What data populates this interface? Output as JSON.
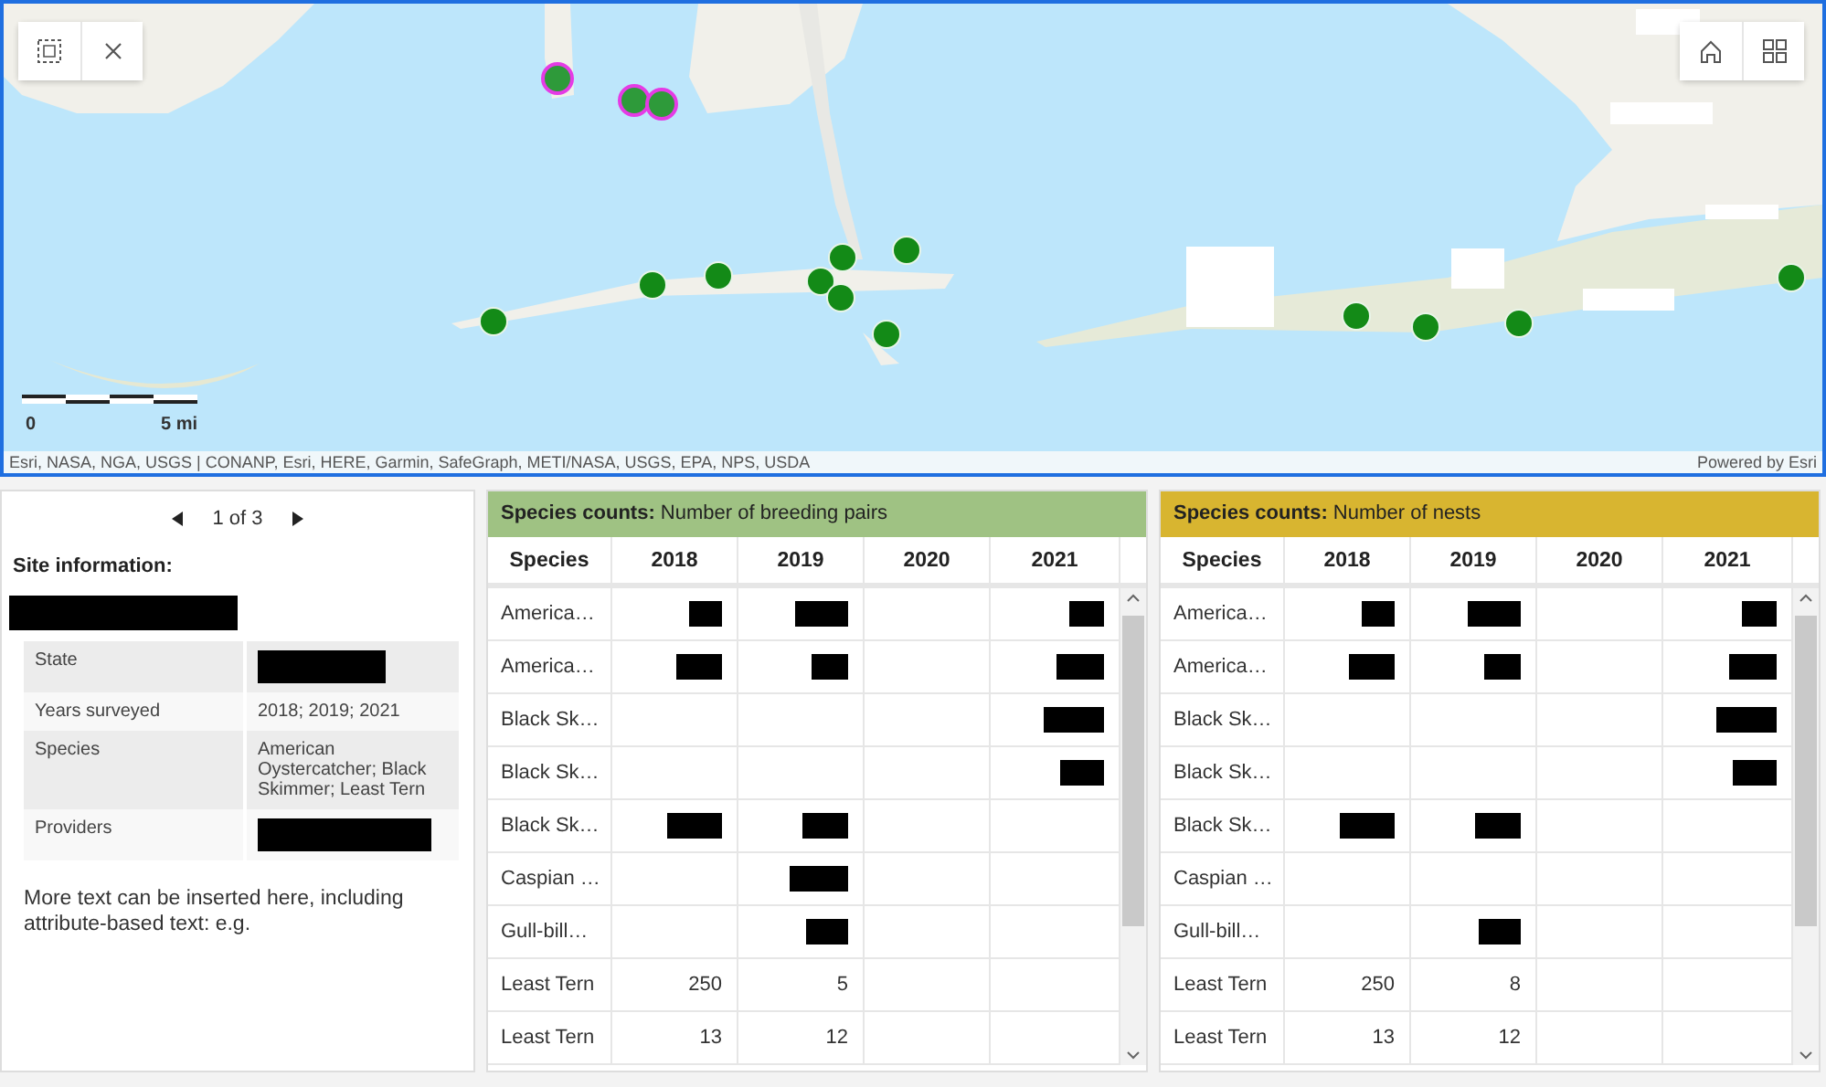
{
  "map": {
    "scale": {
      "start": "0",
      "end": "5 mi"
    },
    "attribution": "Esri, NASA, NGA, USGS | CONANP, Esri, HERE, Garmin, SafeGraph, METI/NASA, USGS, EPA, NPS, USDA",
    "powered_by": "Powered by Esri",
    "markers": [
      {
        "selected": true
      },
      {
        "selected": true
      },
      {
        "selected": true
      },
      {
        "selected": false
      },
      {
        "selected": false
      },
      {
        "selected": false
      },
      {
        "selected": false
      },
      {
        "selected": false
      },
      {
        "selected": false
      },
      {
        "selected": false
      },
      {
        "selected": false
      },
      {
        "selected": false
      },
      {
        "selected": false
      },
      {
        "selected": false
      },
      {
        "selected": false
      }
    ]
  },
  "site_panel": {
    "pager": "1 of 3",
    "heading": "Site information:",
    "name_redacted": true,
    "fields": [
      {
        "label": "State",
        "value": {
          "kind": "redacted"
        }
      },
      {
        "label": "Years surveyed",
        "value": {
          "kind": "text",
          "text": "2018; 2019; 2021"
        }
      },
      {
        "label": "Species",
        "value": {
          "kind": "text",
          "text": "American Oystercatcher; Black Skimmer; Least Tern"
        }
      },
      {
        "label": "Providers",
        "value": {
          "kind": "redacted"
        }
      }
    ],
    "note": "More text can be inserted here, including attribute-based text: e.g."
  },
  "tables": [
    {
      "title": "**Species counts:** Number of breeding pairs",
      "color": "#9fc283",
      "columns": [
        "Species",
        "2018",
        "2019",
        "2020",
        "2021"
      ],
      "rows": [
        {
          "species": "America…",
          "cells": [
            {
              "kind": "redacted"
            },
            {
              "kind": "redacted"
            },
            {
              "kind": "empty"
            },
            {
              "kind": "redacted"
            }
          ]
        },
        {
          "species": "America…",
          "cells": [
            {
              "kind": "redacted"
            },
            {
              "kind": "redacted"
            },
            {
              "kind": "empty"
            },
            {
              "kind": "redacted"
            }
          ]
        },
        {
          "species": "Black Sk…",
          "cells": [
            {
              "kind": "empty"
            },
            {
              "kind": "empty"
            },
            {
              "kind": "empty"
            },
            {
              "kind": "redacted"
            }
          ]
        },
        {
          "species": "Black Sk…",
          "cells": [
            {
              "kind": "empty"
            },
            {
              "kind": "empty"
            },
            {
              "kind": "empty"
            },
            {
              "kind": "redacted"
            }
          ]
        },
        {
          "species": "Black Sk…",
          "cells": [
            {
              "kind": "redacted"
            },
            {
              "kind": "redacted"
            },
            {
              "kind": "empty"
            },
            {
              "kind": "empty"
            }
          ]
        },
        {
          "species": "Caspian …",
          "cells": [
            {
              "kind": "empty"
            },
            {
              "kind": "redacted"
            },
            {
              "kind": "empty"
            },
            {
              "kind": "empty"
            }
          ]
        },
        {
          "species": "Gull-bill…",
          "cells": [
            {
              "kind": "empty"
            },
            {
              "kind": "redacted"
            },
            {
              "kind": "empty"
            },
            {
              "kind": "empty"
            }
          ]
        },
        {
          "species": "Least Tern",
          "cells": [
            {
              "kind": "text",
              "text": "250"
            },
            {
              "kind": "text",
              "text": "5"
            },
            {
              "kind": "empty"
            },
            {
              "kind": "empty"
            }
          ]
        },
        {
          "species": "Least Tern",
          "cells": [
            {
              "kind": "text",
              "text": "13"
            },
            {
              "kind": "text",
              "text": "12"
            },
            {
              "kind": "empty"
            },
            {
              "kind": "empty"
            }
          ]
        }
      ]
    },
    {
      "title": "**Species counts:** Number of nests",
      "color": "#d8b530",
      "columns": [
        "Species",
        "2018",
        "2019",
        "2020",
        "2021"
      ],
      "rows": [
        {
          "species": "America…",
          "cells": [
            {
              "kind": "redacted"
            },
            {
              "kind": "redacted"
            },
            {
              "kind": "empty"
            },
            {
              "kind": "redacted"
            }
          ]
        },
        {
          "species": "America…",
          "cells": [
            {
              "kind": "redacted"
            },
            {
              "kind": "redacted"
            },
            {
              "kind": "empty"
            },
            {
              "kind": "redacted"
            }
          ]
        },
        {
          "species": "Black Sk…",
          "cells": [
            {
              "kind": "empty"
            },
            {
              "kind": "empty"
            },
            {
              "kind": "empty"
            },
            {
              "kind": "redacted"
            }
          ]
        },
        {
          "species": "Black Sk…",
          "cells": [
            {
              "kind": "empty"
            },
            {
              "kind": "empty"
            },
            {
              "kind": "empty"
            },
            {
              "kind": "redacted"
            }
          ]
        },
        {
          "species": "Black Sk…",
          "cells": [
            {
              "kind": "redacted"
            },
            {
              "kind": "redacted"
            },
            {
              "kind": "empty"
            },
            {
              "kind": "empty"
            }
          ]
        },
        {
          "species": "Caspian …",
          "cells": [
            {
              "kind": "empty"
            },
            {
              "kind": "empty"
            },
            {
              "kind": "empty"
            },
            {
              "kind": "empty"
            }
          ]
        },
        {
          "species": "Gull-bill…",
          "cells": [
            {
              "kind": "empty"
            },
            {
              "kind": "redacted"
            },
            {
              "kind": "empty"
            },
            {
              "kind": "empty"
            }
          ]
        },
        {
          "species": "Least Tern",
          "cells": [
            {
              "kind": "text",
              "text": "250"
            },
            {
              "kind": "text",
              "text": "8"
            },
            {
              "kind": "empty"
            },
            {
              "kind": "empty"
            }
          ]
        },
        {
          "species": "Least Tern",
          "cells": [
            {
              "kind": "text",
              "text": "13"
            },
            {
              "kind": "text",
              "text": "12"
            },
            {
              "kind": "empty"
            },
            {
              "kind": "empty"
            }
          ]
        }
      ]
    }
  ]
}
